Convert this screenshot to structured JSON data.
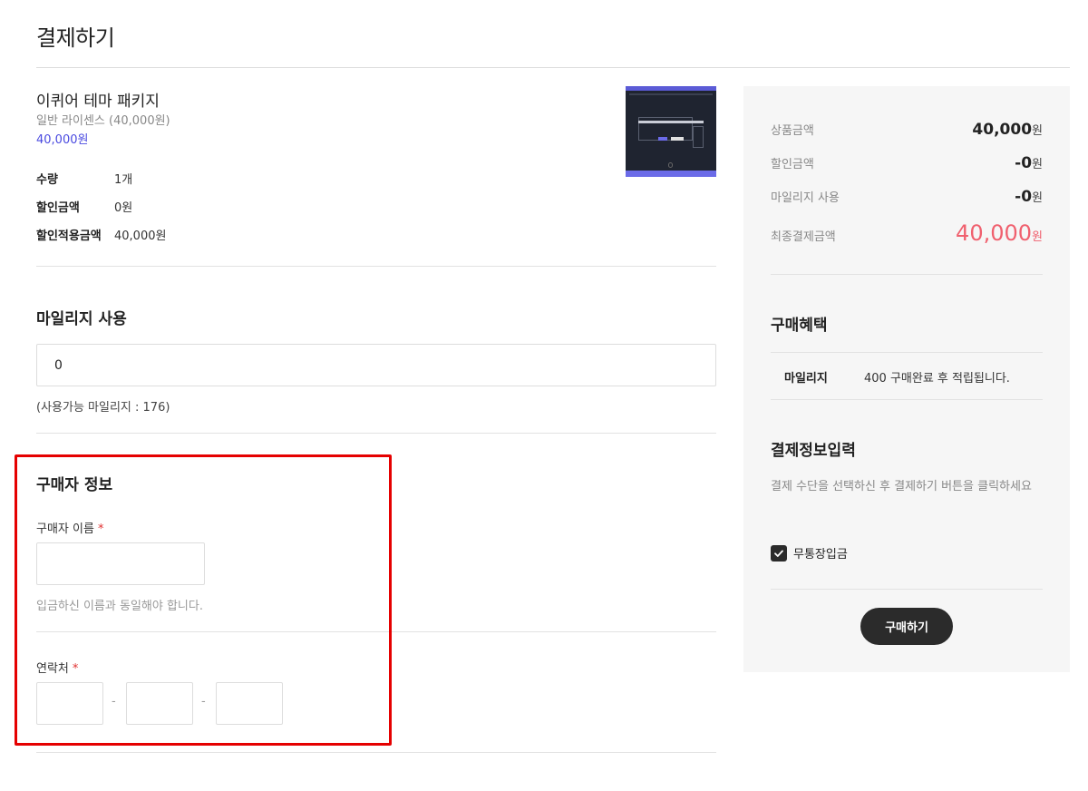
{
  "page": {
    "title": "결제하기"
  },
  "product": {
    "name": "이퀴어 테마 패키지",
    "option": "일반 라이센스 (40,000원)",
    "price": "40,000원",
    "details": [
      {
        "label": "수량",
        "value": "1개"
      },
      {
        "label": "할인금액",
        "value": "0원"
      },
      {
        "label": "할인적용금액",
        "value": "40,000원"
      }
    ],
    "thumbnail": "theme-preview-image"
  },
  "mileage": {
    "title": "마일리지 사용",
    "value": "0",
    "note": "(사용가능 마일리지 : 176)"
  },
  "buyer": {
    "title": "구매자 정보",
    "name_label": "구매자 이름",
    "required_mark": "*",
    "name_help": "입금하신 이름과 동일해야 합니다.",
    "phone_label": "연락처",
    "phone_separator": "-"
  },
  "summary": {
    "rows": [
      {
        "label": "상품금액",
        "value": "40,000",
        "unit": "원"
      },
      {
        "label": "할인금액",
        "value": "-0",
        "unit": "원"
      },
      {
        "label": "마일리지 사용",
        "value": "-0",
        "unit": "원"
      }
    ],
    "final": {
      "label": "최종결제금액",
      "value": "40,000",
      "unit": "원"
    }
  },
  "benefit": {
    "title": "구매혜택",
    "label": "마일리지",
    "value": "400 구매완료 후 적립됩니다."
  },
  "payment": {
    "title": "결제정보입력",
    "description": "결제 수단을 선택하신 후 결제하기 버튼을 클릭하세요",
    "method": "무통장입금",
    "method_checked": true,
    "buy_label": "구매하기"
  },
  "colors": {
    "accent_blue": "#4a4ae0",
    "final_price": "#f0606e",
    "highlight_border": "#e50000",
    "button_dark": "#2b2b2b"
  }
}
